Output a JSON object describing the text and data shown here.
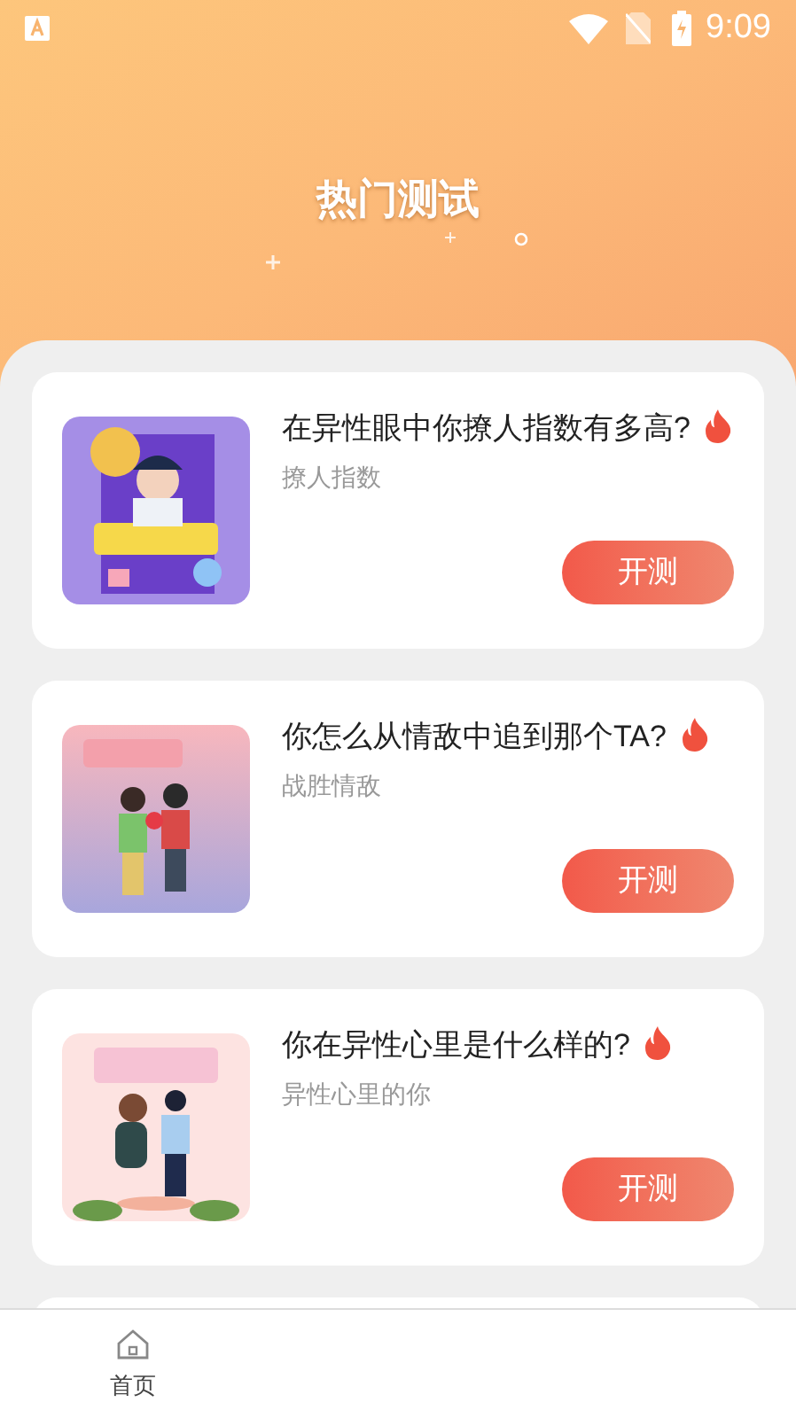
{
  "status_bar": {
    "time": "9:09"
  },
  "header": {
    "title": "热门测试"
  },
  "tests": [
    {
      "title": "在异性眼中你撩人指数有多高?",
      "hot": true,
      "subtitle": "撩人指数",
      "button": "开测"
    },
    {
      "title": "你怎么从情敌中追到那个TA?",
      "hot": true,
      "subtitle": "战胜情敌",
      "button": "开测"
    },
    {
      "title": "你在异性心里是什么样的?",
      "hot": true,
      "subtitle": "异性心里的你",
      "button": "开测"
    }
  ],
  "bottom_nav": [
    {
      "label": "首页",
      "selected": false
    }
  ]
}
